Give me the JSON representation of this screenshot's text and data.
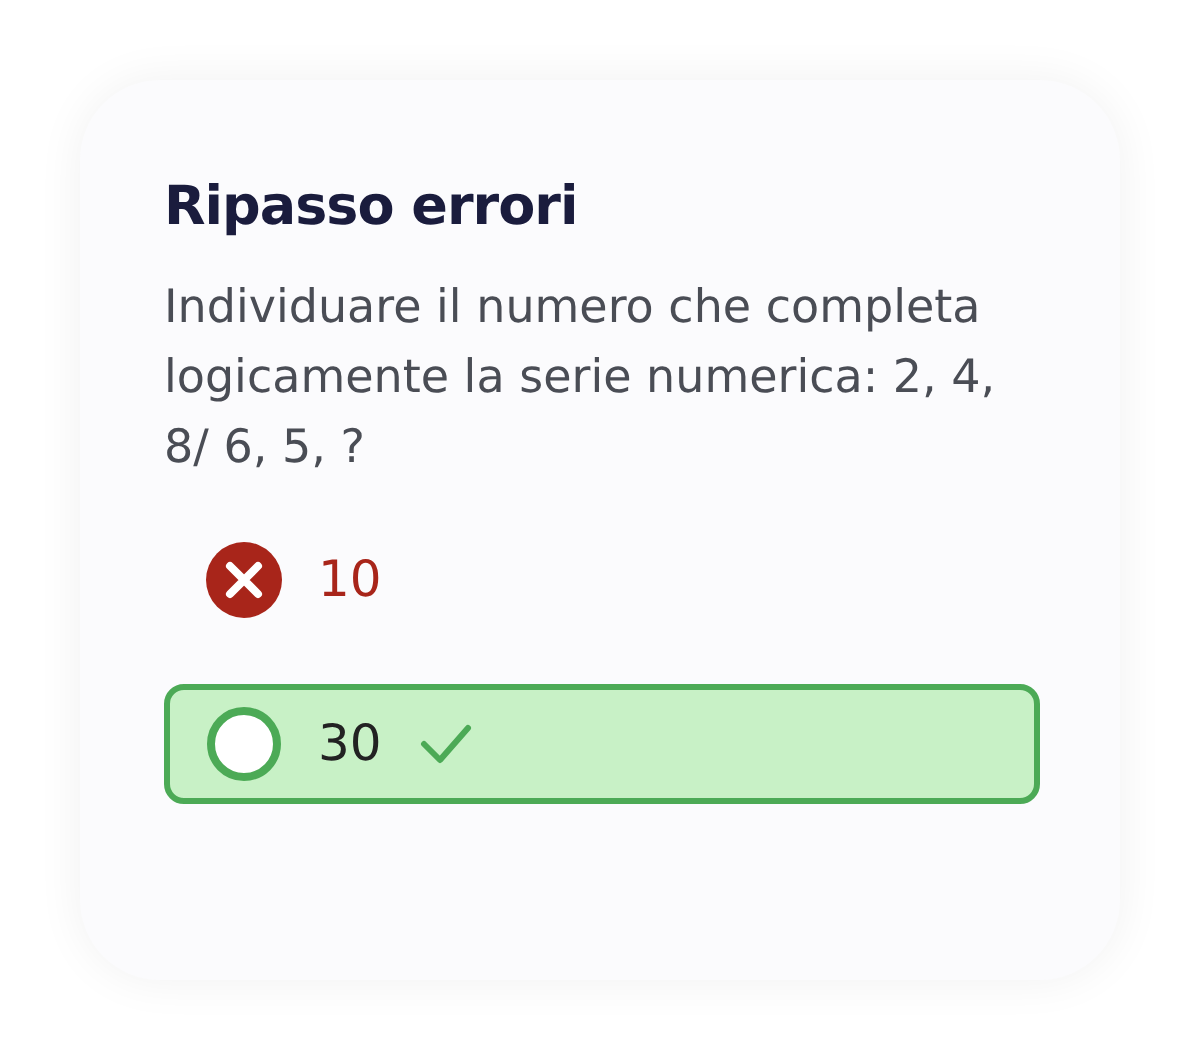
{
  "title": "Ripasso errori",
  "question": "Individuare il numero che completa logicamente la serie numerica: 2, 4, 8/ 6, 5, ?",
  "answers": [
    {
      "label": "10",
      "selected": true,
      "correct": false
    },
    {
      "label": "30",
      "selected": false,
      "correct": true
    }
  ]
}
